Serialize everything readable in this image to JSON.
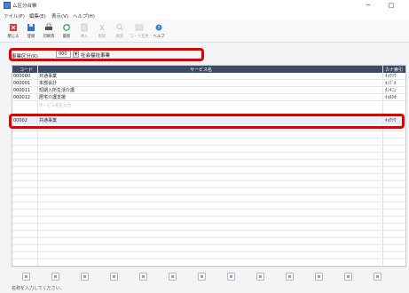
{
  "window": {
    "title": "ム区分台帳",
    "minimize": "−",
    "maximize": "□"
  },
  "menu": [
    "ァイル(F)",
    "編集(E)",
    "表示(V)",
    "ヘルプ(H)"
  ],
  "toolbar": [
    {
      "label": "閉じる",
      "icon": "close-icon",
      "disabled": false
    },
    {
      "label": "登録",
      "icon": "register-icon",
      "disabled": false
    },
    {
      "label": "印刷等",
      "icon": "print-icon",
      "disabled": false
    },
    {
      "label": "最新",
      "icon": "refresh-icon",
      "disabled": false
    },
    {
      "label": "挿入",
      "icon": "insert-icon",
      "disabled": true
    },
    {
      "label": "削除",
      "icon": "delete-icon",
      "disabled": true
    },
    {
      "label": "検索",
      "icon": "search-icon",
      "disabled": true
    },
    {
      "label": "コード変更",
      "icon": "code-change-icon",
      "disabled": true
    },
    {
      "label": "ヘルプ",
      "icon": "help-icon",
      "disabled": false
    }
  ],
  "filter": {
    "label": "事業区分(K)",
    "code": "000",
    "dropdown": "▼",
    "name": "社会福祉事業"
  },
  "grid": {
    "headers": [
      "コード",
      "サービス名",
      "カナ索引"
    ],
    "rows": [
      {
        "code": "000000",
        "name": "共通事業",
        "kana": "ｷｮｳﾂｳ"
      },
      {
        "code": "000001",
        "name": "本部会計",
        "kana": "ﾎﾝﾌﾞｶ"
      },
      {
        "code": "000011",
        "name": "短期入所生活介護",
        "kana": "ﾀﾝｷﾆｭ"
      },
      {
        "code": "000012",
        "name": "居宅介護支援",
        "kana": "ｷｮﾀｸｶ"
      },
      {
        "code": "00002",
        "name": "共通事業",
        "kana": "ｷｮｳﾂｳ"
      }
    ],
    "hint": "サービス名を入力"
  },
  "status": "名称を入力してください。",
  "accent_red": "#e00000",
  "header_color": "#3c4a64"
}
